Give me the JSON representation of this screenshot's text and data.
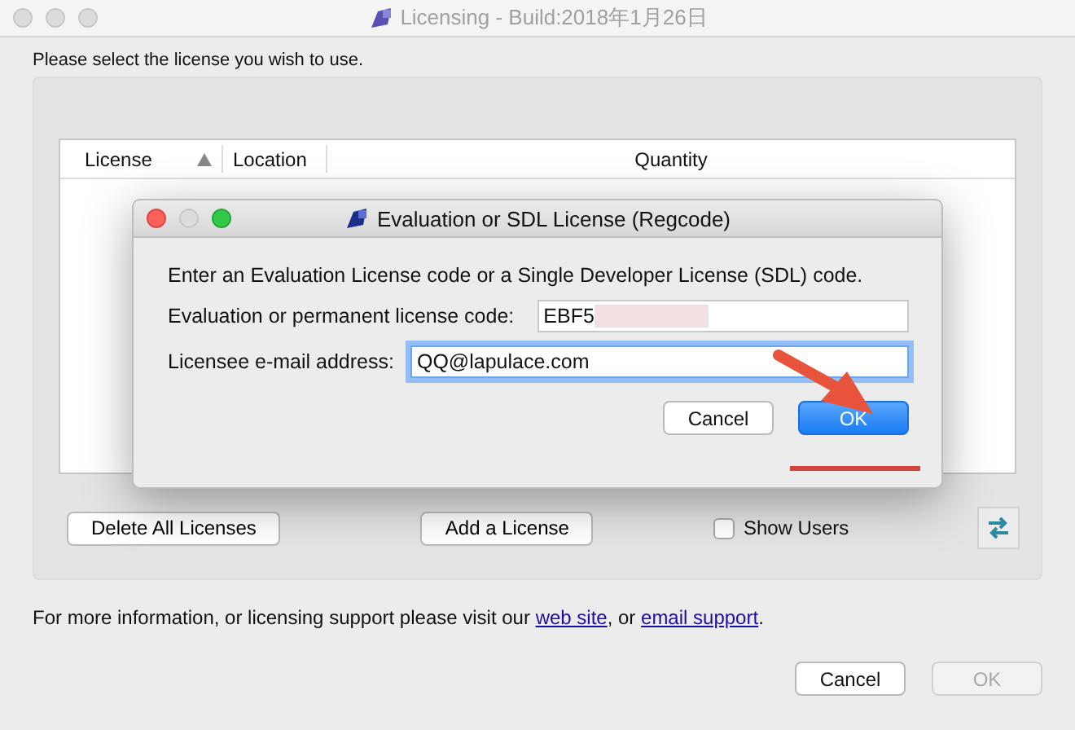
{
  "window": {
    "title": "Licensing - Build:2018年1月26日",
    "active": false
  },
  "instruction": "Please select the license you wish to use.",
  "table": {
    "columns": [
      {
        "label": "License",
        "sorted": true
      },
      {
        "label": "Location",
        "sorted": false
      },
      {
        "label": "Quantity",
        "sorted": false
      }
    ]
  },
  "panel_buttons": [
    {
      "label": "Delete All Licenses"
    },
    {
      "label": "Add a License"
    }
  ],
  "show_users": {
    "label": "Show Users",
    "checked": false
  },
  "footer": [
    {
      "kind": "text",
      "text": "For more information, or licensing support please visit our "
    },
    {
      "kind": "link",
      "text": "web site"
    },
    {
      "kind": "text",
      "text": ", or "
    },
    {
      "kind": "link",
      "text": "email support"
    },
    {
      "kind": "text",
      "text": "."
    }
  ],
  "buttons": [
    {
      "label": "Cancel",
      "disabled": false,
      "default": false
    },
    {
      "label": "OK",
      "disabled": true,
      "default": false
    }
  ],
  "dialog": {
    "title": "Evaluation or SDL License (Regcode)",
    "active": true,
    "prompt": "Enter an Evaluation License code or a Single Developer License (SDL) code.",
    "fields": [
      {
        "label": "Evaluation or permanent license code:",
        "value": "EBF5",
        "redacted": true,
        "focused": false
      },
      {
        "label": "Licensee e-mail address:",
        "value": "QQ@lapulace.com",
        "focused": true
      }
    ],
    "buttons": [
      {
        "label": "Cancel",
        "disabled": false,
        "default": false
      },
      {
        "label": "OK",
        "disabled": false,
        "default": true
      }
    ]
  }
}
